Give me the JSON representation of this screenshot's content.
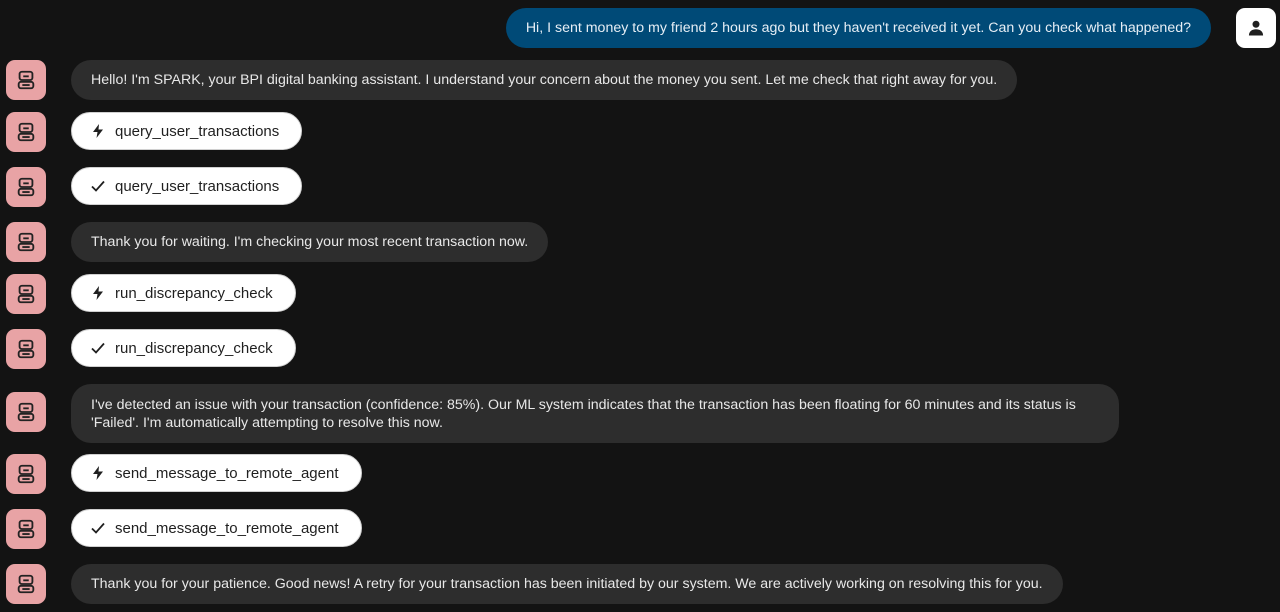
{
  "user_message": {
    "text": "Hi, I sent money to my friend 2 hours ago but they haven't received it yet. Can you check what happened?",
    "avatar_icon": "person-icon"
  },
  "bot": {
    "avatar_icon": "robot-icon",
    "avatar_color": "#e8a3a5"
  },
  "messages": [
    {
      "kind": "text",
      "text": "Hello! I'm SPARK, your BPI digital banking assistant. I understand your concern about the money you sent. Let me check that right away for you."
    },
    {
      "kind": "tool",
      "status": "running",
      "icon": "lightning-icon",
      "text": "query_user_transactions"
    },
    {
      "kind": "tool",
      "status": "done",
      "icon": "checkmark-icon",
      "text": "query_user_transactions"
    },
    {
      "kind": "text",
      "text": "Thank you for waiting. I'm checking your most recent transaction now."
    },
    {
      "kind": "tool",
      "status": "running",
      "icon": "lightning-icon",
      "text": "run_discrepancy_check"
    },
    {
      "kind": "tool",
      "status": "done",
      "icon": "checkmark-icon",
      "text": "run_discrepancy_check"
    },
    {
      "kind": "text",
      "text": "I've detected an issue with your transaction (confidence: 85%). Our ML system indicates that the transaction has been floating for 60 minutes and its status is 'Failed'. I'm automatically attempting to resolve this now."
    },
    {
      "kind": "tool",
      "status": "running",
      "icon": "lightning-icon",
      "text": "send_message_to_remote_agent"
    },
    {
      "kind": "tool",
      "status": "done",
      "icon": "checkmark-icon",
      "text": "send_message_to_remote_agent"
    },
    {
      "kind": "text",
      "text": "Thank you for your patience. Good news! A retry for your transaction has been initiated by our system. We are actively working on resolving this for you."
    }
  ]
}
